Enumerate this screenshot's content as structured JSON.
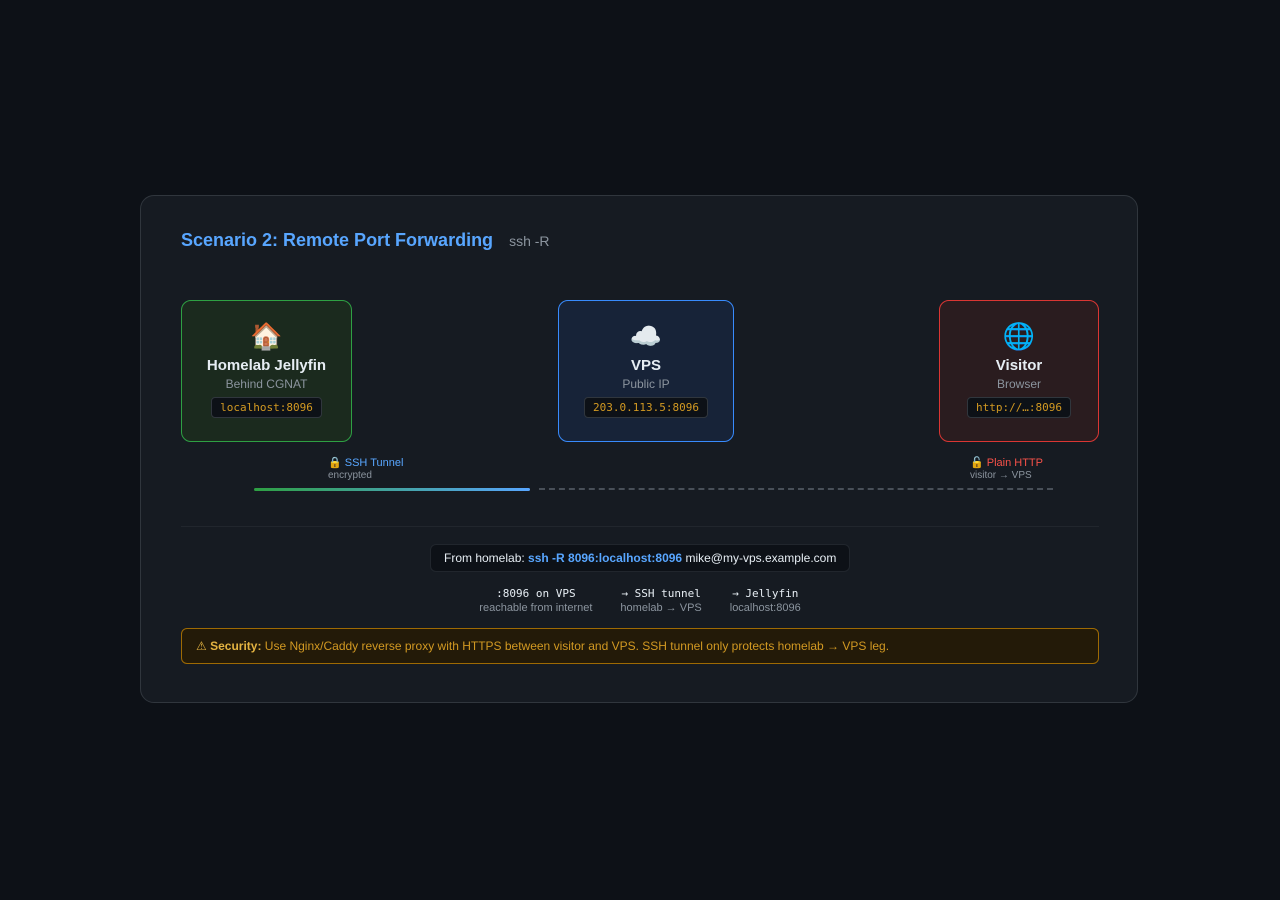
{
  "header": {
    "title": "Scenario 2: Remote Port Forwarding",
    "subtitle": "ssh -R"
  },
  "nodes": [
    {
      "icon": "house-icon",
      "emoji": "🏠",
      "name": "Homelab Jellyfin",
      "desc": "Behind CGNAT",
      "addr": "localhost:8096",
      "border": "#2ea043"
    },
    {
      "icon": "cloud-icon",
      "emoji": "☁️",
      "name": "VPS",
      "desc": "Public IP",
      "addr": "203.0.113.5:8096",
      "border": "#388bfd"
    },
    {
      "icon": "globe-icon",
      "emoji": "🌐",
      "name": "Visitor",
      "desc": "Browser",
      "addr": "http://…:8096",
      "border": "#da3633"
    }
  ],
  "links": {
    "ssh": {
      "label": "🔒 SSH Tunnel",
      "sub": "encrypted"
    },
    "http": {
      "label": "🔓 Plain HTTP",
      "sub": "visitor → VPS"
    }
  },
  "command": {
    "prefix": "From homelab: ",
    "ssh": "ssh -R 8096:localhost:8096",
    "rest": " mike@my-vps.example.com"
  },
  "steps": [
    {
      "top": ":8096 on VPS",
      "bot": "reachable from internet"
    },
    {
      "top": "→ SSH tunnel",
      "bot": "homelab → VPS"
    },
    {
      "top": "→ Jellyfin",
      "bot": "localhost:8096"
    }
  ],
  "security": {
    "icon": "warning-icon",
    "label": "⚠ Security:",
    "text": " Use Nginx/Caddy reverse proxy with HTTPS between visitor and VPS. SSH tunnel only protects homelab → VPS leg."
  },
  "colors": {
    "accent": "#58a6ff",
    "ssh_start": "#2ea043",
    "http": "#f85149",
    "warning": "#d29922"
  }
}
